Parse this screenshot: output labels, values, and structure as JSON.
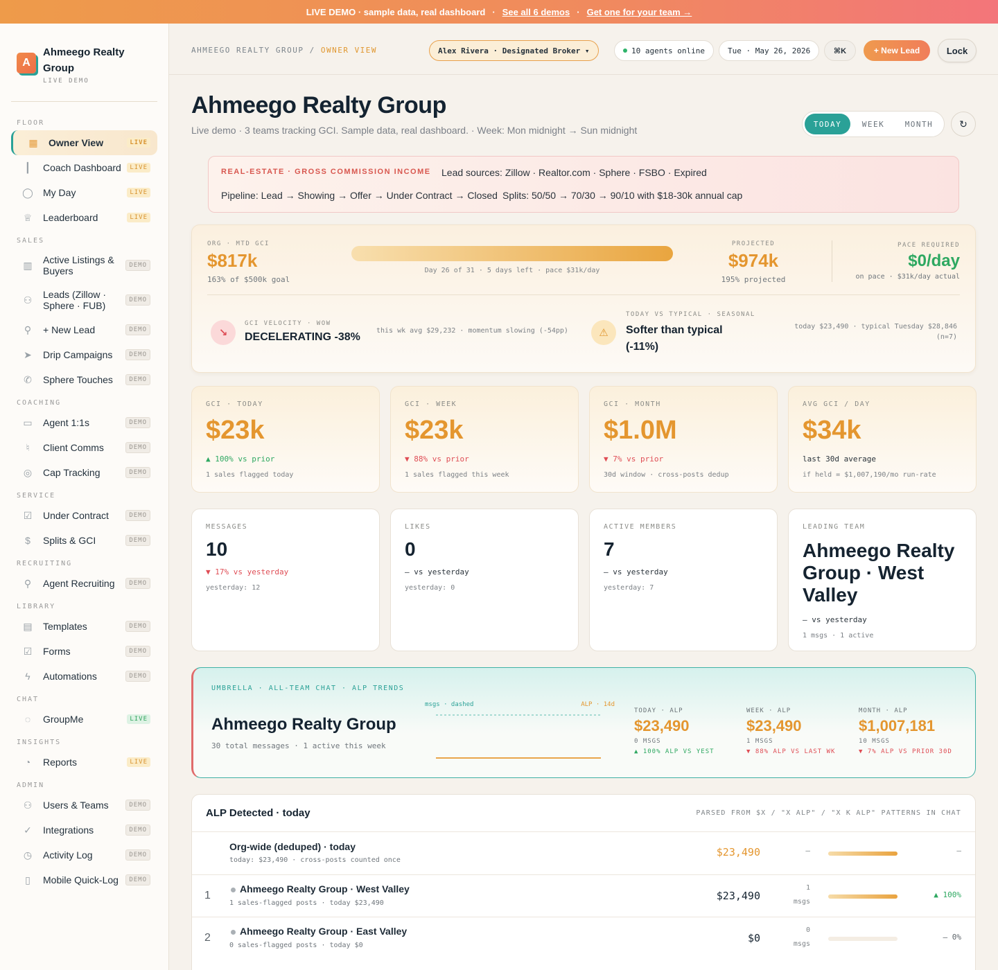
{
  "banner": {
    "text": "LIVE DEMO · sample data, real dashboard",
    "sep": "·",
    "link1": "See all 6 demos",
    "link2": "Get one for your team →"
  },
  "brand": {
    "logo": "A",
    "name": "Ahmeego Realty Group",
    "sub": "LIVE DEMO"
  },
  "nav": [
    {
      "section": "FLOOR",
      "items": [
        {
          "label": "Owner View",
          "badge": "LIVE",
          "kind": "live",
          "icon": "grid-icon",
          "glyph": "▦",
          "active": true
        },
        {
          "label": "Coach Dashboard",
          "badge": "LIVE",
          "kind": "live",
          "icon": "bar-chart-icon",
          "glyph": "┃"
        },
        {
          "label": "My Day",
          "badge": "LIVE",
          "kind": "live",
          "icon": "user-icon",
          "glyph": "◯"
        },
        {
          "label": "Leaderboard",
          "badge": "LIVE",
          "kind": "live",
          "icon": "trophy-icon",
          "glyph": "♕"
        }
      ]
    },
    {
      "section": "SALES",
      "items": [
        {
          "label": "Active Listings & Buyers",
          "badge": "DEMO",
          "kind": "demo",
          "icon": "kanban-icon",
          "glyph": "▥",
          "tall": true
        },
        {
          "label": "Leads (Zillow · Sphere · FUB)",
          "badge": "DEMO",
          "kind": "demo",
          "icon": "users-icon",
          "glyph": "⚇",
          "tall": true
        },
        {
          "label": "+ New Lead",
          "badge": "DEMO",
          "kind": "demo",
          "icon": "user-plus-icon",
          "glyph": "⚲"
        },
        {
          "label": "Drip Campaigns",
          "badge": "DEMO",
          "kind": "demo",
          "icon": "send-icon",
          "glyph": "➤"
        },
        {
          "label": "Sphere Touches",
          "badge": "DEMO",
          "kind": "demo",
          "icon": "phone-icon",
          "glyph": "✆"
        }
      ]
    },
    {
      "section": "COACHING",
      "items": [
        {
          "label": "Agent 1:1s",
          "badge": "DEMO",
          "kind": "demo",
          "icon": "message-square-icon",
          "glyph": "▭"
        },
        {
          "label": "Client Comms",
          "badge": "DEMO",
          "kind": "demo",
          "icon": "mic-icon",
          "glyph": "♮"
        },
        {
          "label": "Cap Tracking",
          "badge": "DEMO",
          "kind": "demo",
          "icon": "target-icon",
          "glyph": "◎"
        }
      ]
    },
    {
      "section": "SERVICE",
      "items": [
        {
          "label": "Under Contract",
          "badge": "DEMO",
          "kind": "demo",
          "icon": "check-square-icon",
          "glyph": "☑"
        },
        {
          "label": "Splits & GCI",
          "badge": "DEMO",
          "kind": "demo",
          "icon": "dollar-icon",
          "glyph": "$"
        }
      ]
    },
    {
      "section": "RECRUITING",
      "items": [
        {
          "label": "Agent Recruiting",
          "badge": "DEMO",
          "kind": "demo",
          "icon": "user-plus-icon",
          "glyph": "⚲"
        }
      ]
    },
    {
      "section": "LIBRARY",
      "items": [
        {
          "label": "Templates",
          "badge": "DEMO",
          "kind": "demo",
          "icon": "file-icon",
          "glyph": "▤"
        },
        {
          "label": "Forms",
          "badge": "DEMO",
          "kind": "demo",
          "icon": "check-square-icon",
          "glyph": "☑"
        },
        {
          "label": "Automations",
          "badge": "DEMO",
          "kind": "demo",
          "icon": "zap-icon",
          "glyph": "ϟ"
        }
      ]
    },
    {
      "section": "CHAT",
      "items": [
        {
          "label": "GroupMe",
          "badge": "LIVE",
          "kind": "livegreen",
          "icon": "chat-bubble-icon",
          "glyph": "◌"
        }
      ]
    },
    {
      "section": "INSIGHTS",
      "items": [
        {
          "label": "Reports",
          "badge": "LIVE",
          "kind": "live",
          "icon": "pie-chart-icon",
          "glyph": "◔"
        }
      ]
    },
    {
      "section": "ADMIN",
      "items": [
        {
          "label": "Users & Teams",
          "badge": "DEMO",
          "kind": "demo",
          "icon": "users-icon",
          "glyph": "⚇"
        },
        {
          "label": "Integrations",
          "badge": "DEMO",
          "kind": "demo",
          "icon": "check-circle-icon",
          "glyph": "✓"
        },
        {
          "label": "Activity Log",
          "badge": "DEMO",
          "kind": "demo",
          "icon": "clock-icon",
          "glyph": "◷"
        },
        {
          "label": "Mobile Quick-Log",
          "badge": "DEMO",
          "kind": "demo",
          "icon": "smartphone-icon",
          "glyph": "▯"
        }
      ]
    }
  ],
  "header": {
    "crumb_org": "AHMEEGO REALTY GROUP",
    "crumb_sep": "/",
    "crumb_view": "OWNER VIEW",
    "user": "Alex Rivera · Designated Broker ▾",
    "online": "10 agents online",
    "date": "Tue · May 26, 2026",
    "cmdk": "⌘K",
    "new_lead": "+ New Lead",
    "lock": "Lock"
  },
  "page": {
    "title": "Ahmeego Realty Group",
    "subtitle": "Live demo · 3 teams tracking GCI. Sample data, real dashboard. · Week: Mon midnight → Sun midnight",
    "tabs": [
      "TODAY",
      "WEEK",
      "MONTH"
    ],
    "refresh": "↻"
  },
  "info": {
    "tag": "REAL-ESTATE · GROSS COMMISSION INCOME",
    "sources": "Lead sources: Zillow · Realtor.com · Sphere · FSBO · Expired",
    "pipeline": "Pipeline: Lead → Showing → Offer → Under Contract → Closed",
    "splits": "Splits: 50/50 → 70/30 → 90/10 with $18-30k annual cap"
  },
  "mtd": {
    "label": "ORG · MTD GCI",
    "value": "$817k",
    "goal": "163% of $500k goal",
    "progress_pct": 100,
    "bar_caption": "Day 26 of 31 · 5 days left · pace $31k/day",
    "proj_label": "PROJECTED",
    "proj_value": "$974k",
    "proj_sub": "195% projected",
    "pace_label": "PACE REQUIRED",
    "pace_value": "$0/day",
    "pace_sub": "on pace · $31k/day actual",
    "vel_label": "GCI VELOCITY · WOW",
    "vel_value": "DECELERATING -38%",
    "vel_icon": "↘",
    "vel_note": "this wk avg $29,232 · momentum slowing (-54pp)",
    "typ_label": "TODAY VS TYPICAL · SEASONAL",
    "typ_value_1": "Softer than typical",
    "typ_value_2": "(-11%)",
    "typ_icon": "⚠",
    "typ_note_1": "today $23,490 · typical Tuesday $28,846",
    "typ_note_2": "(n=7)"
  },
  "cards_top": [
    {
      "label": "GCI · TODAY",
      "value": "$23k",
      "change": "▲ 100% vs prior",
      "dir": "up",
      "note": "1 sales flagged today"
    },
    {
      "label": "GCI · WEEK",
      "value": "$23k",
      "change": "▼ 88% vs prior",
      "dir": "down",
      "note": "1 sales flagged this week"
    },
    {
      "label": "GCI · MONTH",
      "value": "$1.0M",
      "change": "▼ 7% vs prior",
      "dir": "down",
      "note": "30d window · cross-posts dedup"
    },
    {
      "label": "AVG GCI / DAY",
      "value": "$34k",
      "change": "last 30d average",
      "dir": "flat",
      "note": "if held = $1,007,190/mo run-rate"
    }
  ],
  "cards_mid": [
    {
      "label": "MESSAGES",
      "value": "10",
      "change": "▼ 17% vs yesterday",
      "dir": "down",
      "note": "yesterday: 12"
    },
    {
      "label": "LIKES",
      "value": "0",
      "change": "— vs yesterday",
      "dir": "flat",
      "note": "yesterday: 0"
    },
    {
      "label": "ACTIVE MEMBERS",
      "value": "7",
      "change": "— vs yesterday",
      "dir": "flat",
      "note": "yesterday: 7"
    },
    {
      "label": "LEADING TEAM",
      "value_1": "Ahmeego Realty",
      "value_2": "Group · West",
      "value_3": "Valley",
      "change": "— vs yesterday",
      "dir": "flat",
      "note": "1 msgs · 1 active"
    }
  ],
  "umbrella": {
    "label": "UMBRELLA · ALL-TEAM CHAT · ALP TRENDS",
    "title": "Ahmeego Realty Group",
    "sub": "30 total messages · 1 active this week",
    "legend_msgs": "msgs · dashed",
    "legend_alp": "ALP · 14d",
    "stats": [
      {
        "label": "TODAY · ALP",
        "value": "$23,490",
        "msgs": "0 MSGS",
        "change": "▲ 100% ALP VS YEST",
        "dir": "up"
      },
      {
        "label": "WEEK · ALP",
        "value": "$23,490",
        "msgs": "1 MSGS",
        "change": "▼ 88% ALP VS LAST WK",
        "dir": "down"
      },
      {
        "label": "MONTH · ALP",
        "value": "$1,007,181",
        "msgs": "10 MSGS",
        "change": "▼ 7% ALP VS PRIOR 30D",
        "dir": "down"
      }
    ]
  },
  "alp": {
    "title": "ALP Detected · today",
    "hint": "PARSED FROM $X / \"X ALP\" / \"X K ALP\" PATTERNS IN CHAT",
    "org": {
      "name": "Org-wide (deduped) · today",
      "sub": "today: $23,490 · cross-posts counted once",
      "value": "$23,490",
      "msgs": "—",
      "change": "—",
      "fill": 1.0
    },
    "rows": [
      {
        "rank": "1",
        "name": "Ahmeego Realty Group · West Valley",
        "sub": "1 sales-flagged posts · today $23,490",
        "value": "$23,490",
        "msgs_n": "1",
        "msgs_l": "msgs",
        "change": "▲ 100%",
        "dir": "up",
        "fill": 1.0
      },
      {
        "rank": "2",
        "name": "Ahmeego Realty Group · East Valley",
        "sub": "0 sales-flagged posts · today $0",
        "value": "$0",
        "msgs_n": "0",
        "msgs_l": "msgs",
        "change": "— 0%",
        "dir": "flat",
        "fill": 0.0
      }
    ]
  }
}
